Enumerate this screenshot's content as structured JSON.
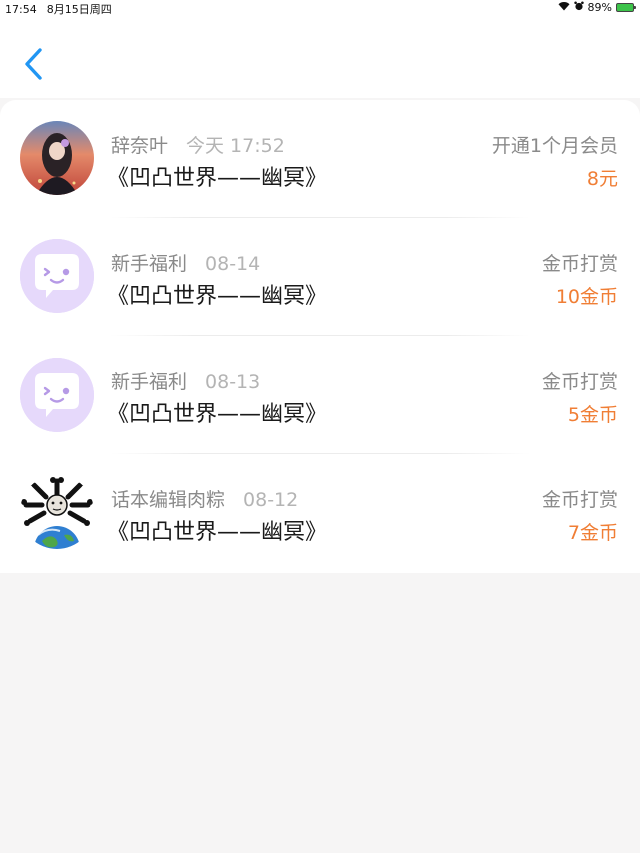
{
  "status_bar": {
    "time": "17:54",
    "date": "8月15日周四",
    "battery_percent": "89%"
  },
  "colors": {
    "accent_blue": "#2196f3",
    "amount_orange": "#f07e35"
  },
  "records": [
    {
      "sender": "辞奈叶",
      "time": "今天 17:52",
      "title": "《凹凸世界——幽冥》",
      "reward_type": "开通1个月会员",
      "amount": "8元",
      "avatar": "character-portrait"
    },
    {
      "sender": "新手福利",
      "time": "08-14",
      "title": "《凹凸世界——幽冥》",
      "reward_type": "金币打赏",
      "amount": "10金币",
      "avatar": "chat-bubble-mascot"
    },
    {
      "sender": "新手福利",
      "time": "08-13",
      "title": "《凹凸世界——幽冥》",
      "reward_type": "金币打赏",
      "amount": "5金币",
      "avatar": "chat-bubble-mascot"
    },
    {
      "sender": "话本编辑肉粽",
      "time": "08-12",
      "title": "《凹凸世界——幽冥》",
      "reward_type": "金币打赏",
      "amount": "7金币",
      "avatar": "earth-bones-meme"
    }
  ]
}
